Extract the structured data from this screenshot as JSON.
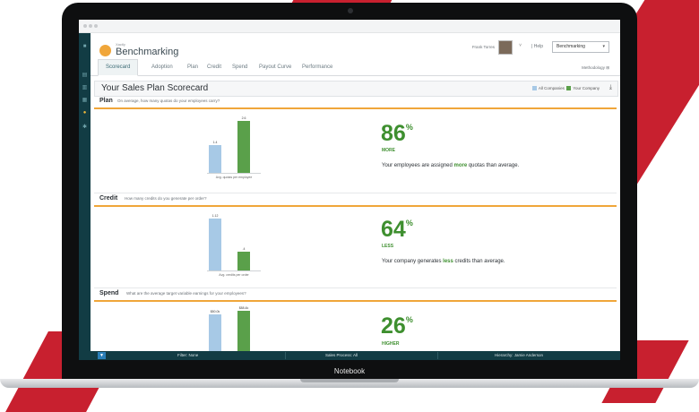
{
  "app": {
    "brand_small": "Xactly",
    "brand_name": "Benchmarking"
  },
  "header": {
    "user_name": "Frank Torres",
    "user_chevron": "˅",
    "help_label": "| Help",
    "selector_value": "Benchmarking",
    "selector_chevron": "▾",
    "methodology": "Methodology"
  },
  "tabs": [
    {
      "label": "Scorecard"
    },
    {
      "label": "Adoption"
    },
    {
      "label": "Plan"
    },
    {
      "label": "Credit"
    },
    {
      "label": "Spend"
    },
    {
      "label": "Payout Curve"
    },
    {
      "label": "Performance"
    }
  ],
  "scorecard": {
    "title": "Your Sales Plan Scorecard",
    "legend_all": "All Companies",
    "legend_you": "Your Company",
    "download_icon": "⤓"
  },
  "colors": {
    "all_companies": "#a7c9e6",
    "your_company": "#5aa04a",
    "accent": "#f0a63a",
    "positive": "#3e8f2f",
    "sidebar": "#123c44"
  },
  "sections": [
    {
      "name": "Plan",
      "question": "On average, how many quotas do your employees carry?",
      "percent": "86",
      "percent_sign": "%",
      "direction": "MORE",
      "statement_pre": "Your employees are assigned ",
      "statement_emph": "more",
      "statement_post": " quotas than average.",
      "x_label": "Avg. quotas per employee",
      "values_text": [
        "1.4",
        "2.6"
      ]
    },
    {
      "name": "Credit",
      "question": "How many credits do you generate per order?",
      "percent": "64",
      "percent_sign": "%",
      "direction": "LESS",
      "statement_pre": "Your company generates ",
      "statement_emph": "less",
      "statement_post": " credits than average.",
      "x_label": "Avg. credits per order",
      "values_text": [
        "1.12",
        ".4"
      ]
    },
    {
      "name": "Spend",
      "question": "What are the average target variable earnings for your employees?",
      "percent": "26",
      "percent_sign": "%",
      "direction": "HIGHER",
      "values_text": [
        "$80.0k",
        "$88.4k"
      ]
    }
  ],
  "chart_data": [
    {
      "type": "bar",
      "categories": [
        "All Companies",
        "Your Company"
      ],
      "values": [
        1.4,
        2.6
      ],
      "xlabel": "Avg. quotas per employee",
      "ylim": [
        0,
        2.8
      ]
    },
    {
      "type": "bar",
      "categories": [
        "All Companies",
        "Your Company"
      ],
      "values": [
        1.12,
        0.4
      ],
      "xlabel": "Avg. credits per order",
      "ylim": [
        0,
        1.2
      ]
    },
    {
      "type": "bar",
      "categories": [
        "All Companies",
        "Your Company"
      ],
      "values": [
        80.0,
        88.4
      ],
      "xlabel": "",
      "ylim": [
        0,
        90
      ]
    }
  ],
  "filter_bar": {
    "filter_icon": "▼",
    "filter": "Filter: None",
    "sales_process": "Sales Process: All",
    "hierarchy": "Hierarchy: Jamie Anderson"
  },
  "device": {
    "label": "Notebook"
  }
}
